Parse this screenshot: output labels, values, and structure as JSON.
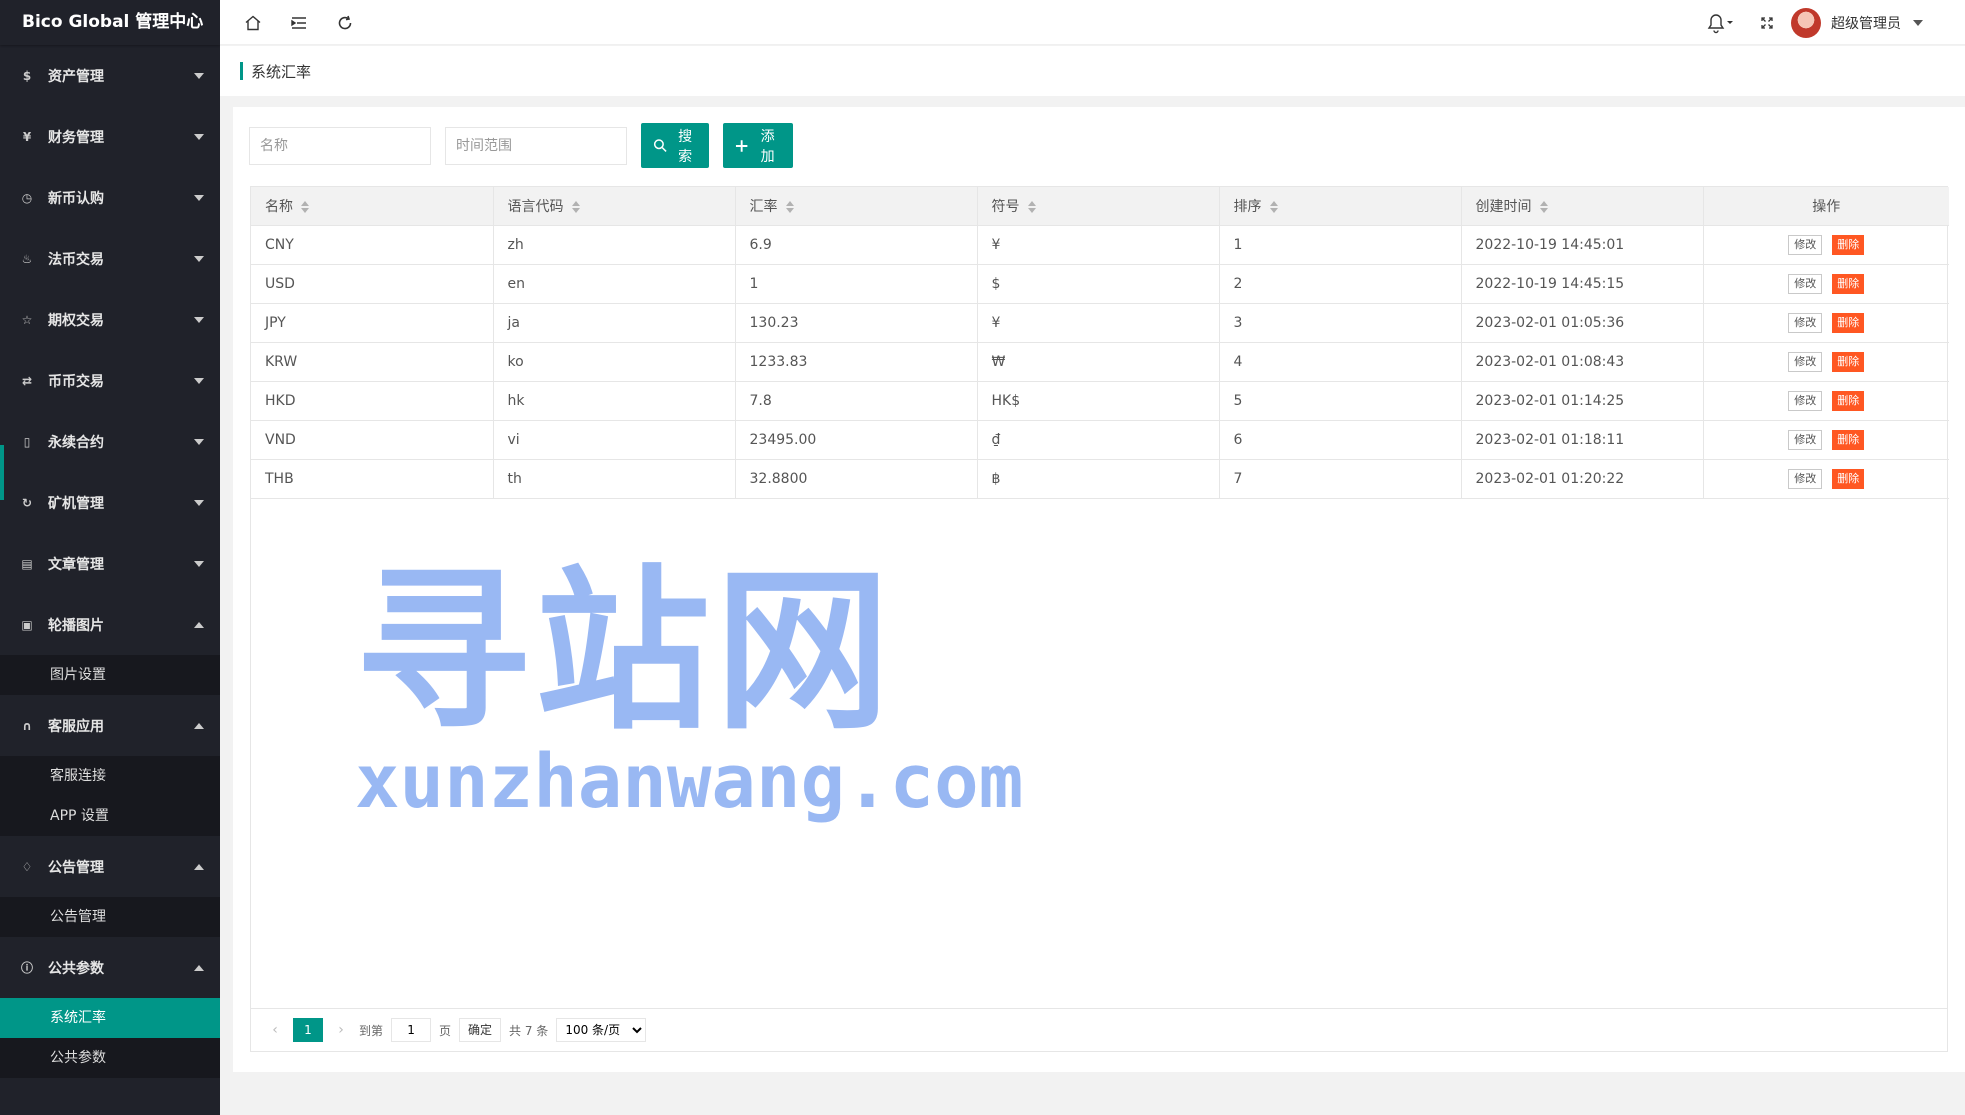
{
  "app": {
    "logo_text": "Bico Global 管理中心"
  },
  "colors": {
    "primary": "#009688",
    "danger": "#ff5722",
    "sidebar_bg": "#20222a",
    "watermark": "#8fb1f2"
  },
  "sidebar": {
    "groups": [
      {
        "label": "资产管理",
        "icon": "dollar-circle-icon"
      },
      {
        "label": "财务管理",
        "icon": "yen-circle-icon"
      },
      {
        "label": "新币认购",
        "icon": "clock-icon"
      },
      {
        "label": "法币交易",
        "icon": "fire-icon"
      },
      {
        "label": "期权交易",
        "icon": "star-icon"
      },
      {
        "label": "币币交易",
        "icon": "exchange-icon"
      },
      {
        "label": "永续合约",
        "icon": "file-icon"
      },
      {
        "label": "矿机管理",
        "icon": "refresh-icon"
      },
      {
        "label": "文章管理",
        "icon": "book-icon"
      },
      {
        "label": "轮播图片",
        "icon": "image-icon",
        "children": [
          "图片设置"
        ]
      },
      {
        "label": "客服应用",
        "icon": "headset-icon",
        "children": [
          "客服连接",
          "APP 设置"
        ]
      },
      {
        "label": "公告管理",
        "icon": "bell-icon",
        "children": [
          "公告管理"
        ]
      },
      {
        "label": "公共参数",
        "icon": "info-icon",
        "children": [
          "系统汇率",
          "公共参数"
        ]
      }
    ]
  },
  "header": {
    "user_name": "超级管理员",
    "icons": [
      "home-icon",
      "menu-fold-icon",
      "refresh-icon",
      "bell-icon",
      "fullscreen-icon"
    ]
  },
  "breadcrumb": {
    "current": "系统汇率"
  },
  "toolbar": {
    "name_placeholder": "名称",
    "time_placeholder": "时间范围",
    "search_label": "搜索",
    "add_label": "添加"
  },
  "table": {
    "columns": [
      "名称",
      "语言代码",
      "汇率",
      "符号",
      "排序",
      "创建时间",
      "操作"
    ],
    "rows": [
      {
        "name": "CNY",
        "lang": "zh",
        "rate": "6.9",
        "symbol": "¥",
        "sort": "1",
        "created": "2022-10-19 14:45:01"
      },
      {
        "name": "USD",
        "lang": "en",
        "rate": "1",
        "symbol": "$",
        "sort": "2",
        "created": "2022-10-19 14:45:15"
      },
      {
        "name": "JPY",
        "lang": "ja",
        "rate": "130.23",
        "symbol": "¥",
        "sort": "3",
        "created": "2023-02-01 01:05:36"
      },
      {
        "name": "KRW",
        "lang": "ko",
        "rate": "1233.83",
        "symbol": "₩",
        "sort": "4",
        "created": "2023-02-01 01:08:43"
      },
      {
        "name": "HKD",
        "lang": "hk",
        "rate": "7.8",
        "symbol": "HK$",
        "sort": "5",
        "created": "2023-02-01 01:14:25"
      },
      {
        "name": "VND",
        "lang": "vi",
        "rate": "23495.00",
        "symbol": "₫",
        "sort": "6",
        "created": "2023-02-01 01:18:11"
      },
      {
        "name": "THB",
        "lang": "th",
        "rate": "32.8800",
        "symbol": "฿",
        "sort": "7",
        "created": "2023-02-01 01:20:22"
      }
    ],
    "edit_label": "修改",
    "delete_label": "删除"
  },
  "pager": {
    "current_page": "1",
    "goto_label": "到第",
    "goto_value": "1",
    "page_unit": "页",
    "confirm_label": "确定",
    "total_text": "共 7 条",
    "per_page": "100 条/页"
  },
  "watermark": {
    "cn": "寻站网",
    "en": "xunzhanwang.com"
  }
}
